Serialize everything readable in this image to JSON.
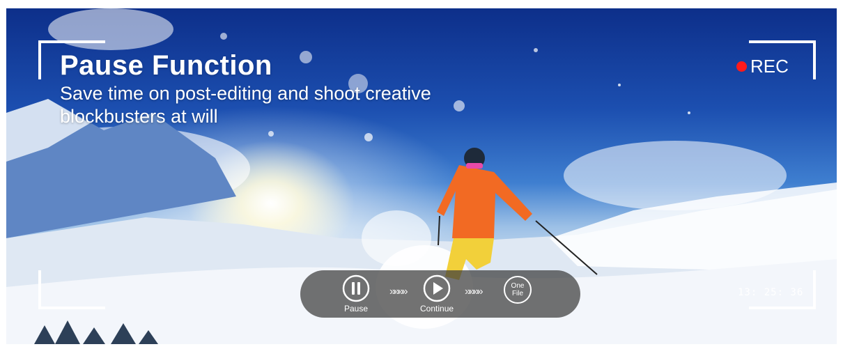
{
  "hero": {
    "title": "Pause Function",
    "subtitle": "Save time on post-editing and shoot creative blockbusters at will"
  },
  "recording": {
    "label": "REC",
    "dot_color": "#ff1a1a",
    "timecode": "13: 25: 36"
  },
  "controls": {
    "pause_label": "Pause",
    "continue_label": "Continue",
    "one_file_line1": "One",
    "one_file_line2": "File",
    "arrows": "»»»»"
  }
}
